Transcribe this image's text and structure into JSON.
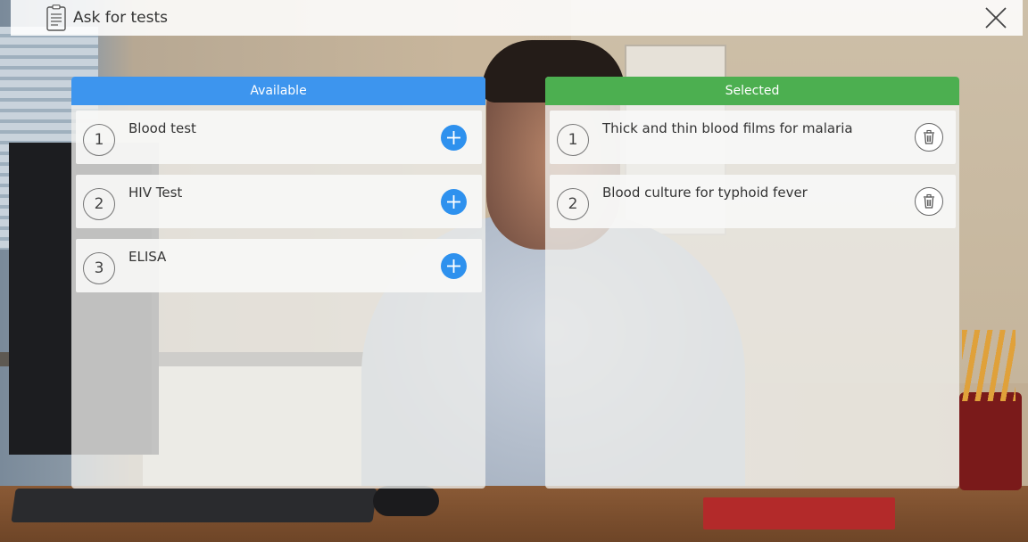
{
  "header": {
    "title": "Ask for tests",
    "icon": "clipboard-icon",
    "close_icon": "close-icon"
  },
  "available": {
    "heading": "Available",
    "color": "#3d95ee",
    "items": [
      {
        "number": "1",
        "label": "Blood test"
      },
      {
        "number": "2",
        "label": "HIV Test"
      },
      {
        "number": "3",
        "label": "ELISA"
      }
    ],
    "action_icon": "plus-icon"
  },
  "selected": {
    "heading": "Selected",
    "color": "#4caf50",
    "items": [
      {
        "number": "1",
        "label": "Thick and thin blood films for malaria"
      },
      {
        "number": "2",
        "label": "Blood culture for typhoid fever"
      }
    ],
    "action_icon": "trash-icon"
  }
}
